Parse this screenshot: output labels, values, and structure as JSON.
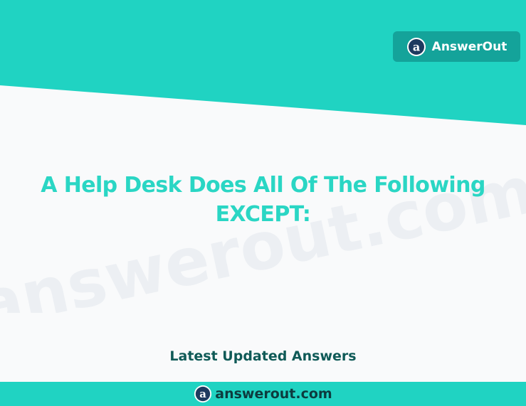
{
  "header": {
    "brand_label": "AnswerOut",
    "logo_icon": "answerout-logo-icon"
  },
  "main": {
    "question_title": "A Help Desk Does All Of The Following EXCEPT:",
    "subtitle": "Latest Updated Answers"
  },
  "watermark": {
    "text": "answerout.com"
  },
  "footer": {
    "domain": "answerout.com",
    "logo_icon": "answerout-logo-icon"
  },
  "colors": {
    "teal_band": "#20d3c2",
    "title_teal": "#2ad6c4",
    "brand_button": "#14a39a",
    "dark_teal_text": "#0f5a57",
    "background": "#f9fafb"
  }
}
